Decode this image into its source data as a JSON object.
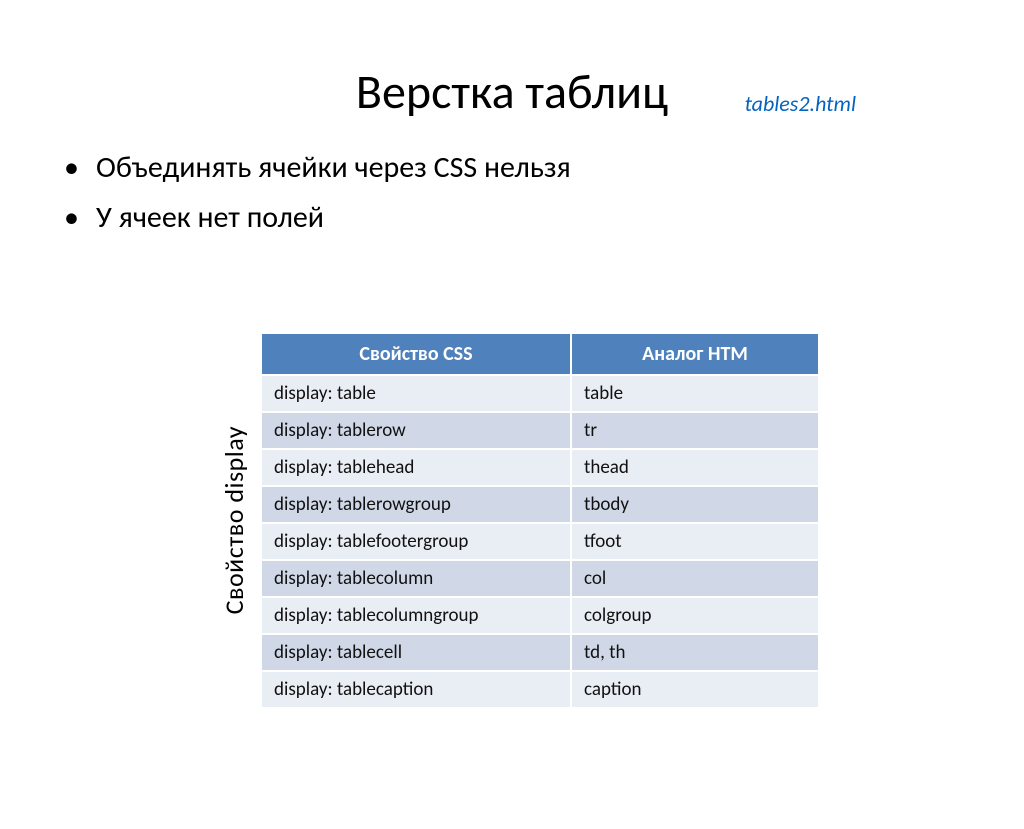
{
  "filename": "tables2.html",
  "title": "Верстка таблиц",
  "bullets": [
    "Объединять ячейки через CSS нельзя",
    "У ячеек нет полей"
  ],
  "side_label": "Свойство display",
  "table": {
    "headers": [
      "Свойство CSS",
      "Аналог HTM"
    ],
    "rows": [
      [
        "display: table",
        "table"
      ],
      [
        "display: tablerow",
        "tr"
      ],
      [
        "display: tablehead",
        "thead"
      ],
      [
        "display: tablerowgroup",
        "tbody"
      ],
      [
        "display: tablefootergroup",
        "tfoot"
      ],
      [
        "display: tablecolumn",
        "col"
      ],
      [
        "display: tablecolumngroup",
        "colgroup"
      ],
      [
        "display: tablecell",
        "td, th"
      ],
      [
        "display: tablecaption",
        "caption"
      ]
    ]
  }
}
